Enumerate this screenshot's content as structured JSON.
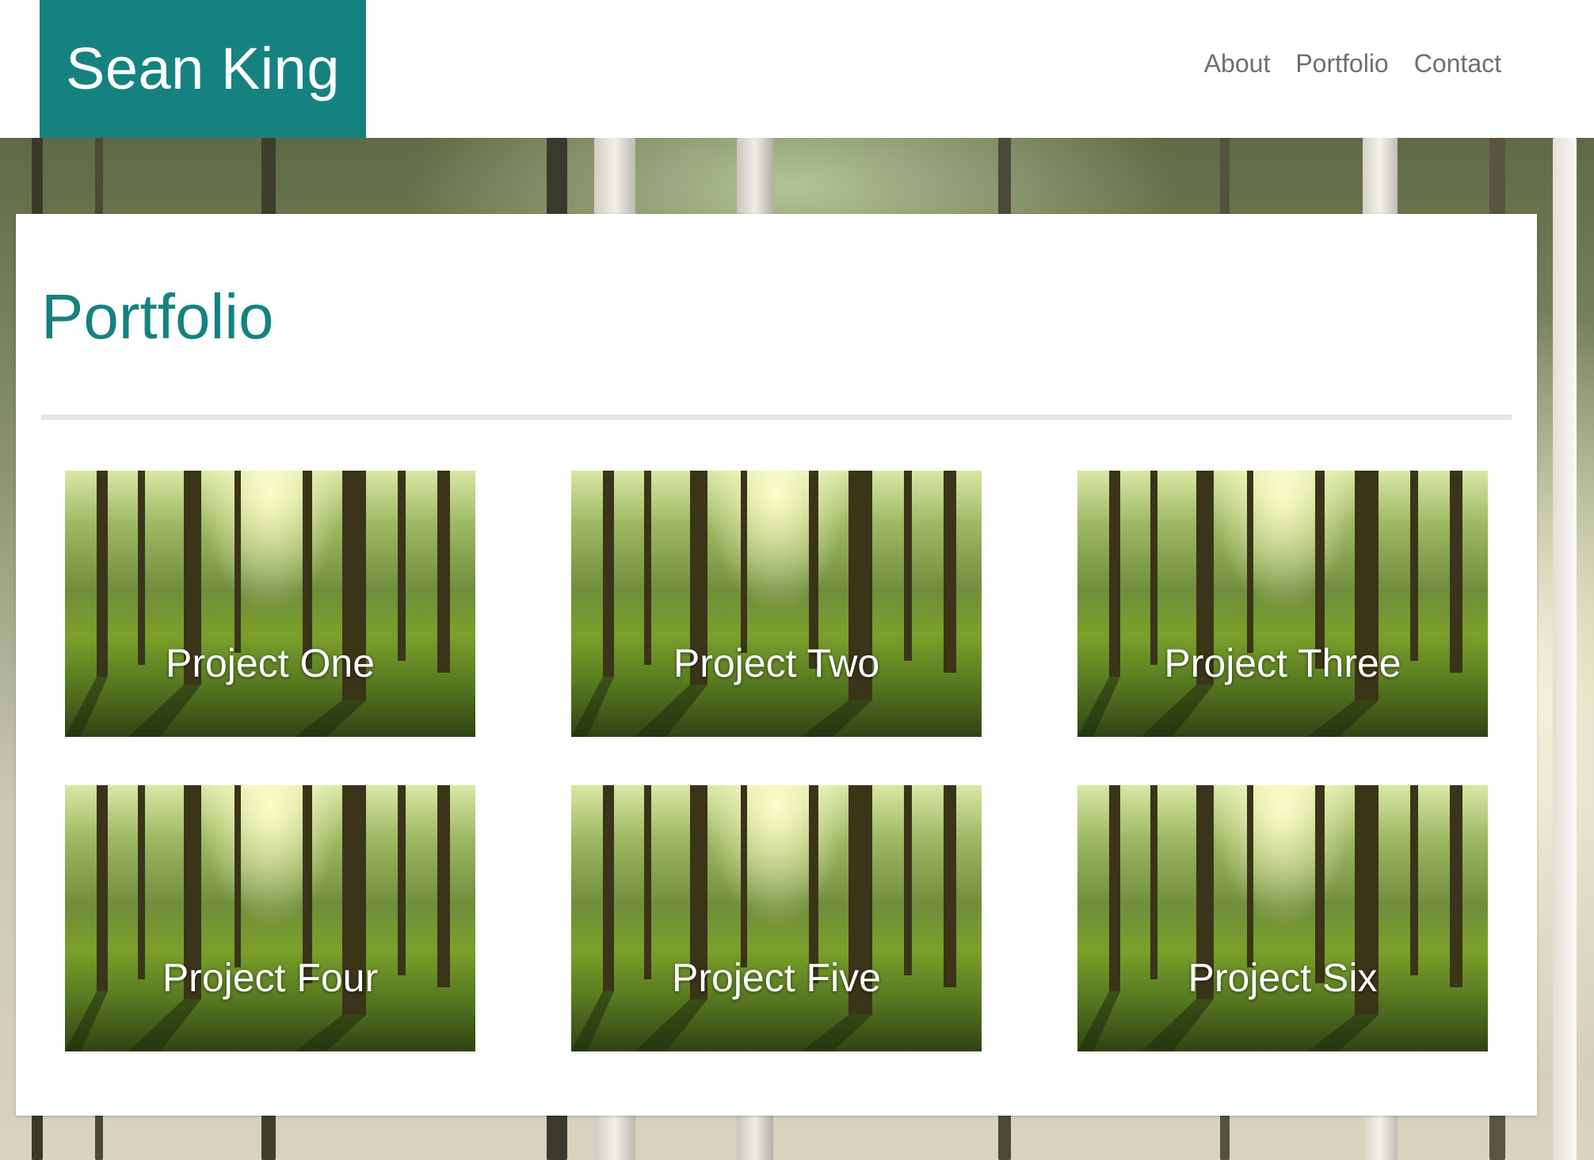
{
  "header": {
    "brand": "Sean King",
    "nav": [
      "About",
      "Portfolio",
      "Contact"
    ]
  },
  "main": {
    "title": "Portfolio",
    "projects": [
      {
        "label": "Project One"
      },
      {
        "label": "Project Two"
      },
      {
        "label": "Project Three"
      },
      {
        "label": "Project Four"
      },
      {
        "label": "Project Five"
      },
      {
        "label": "Project Six"
      }
    ]
  },
  "colors": {
    "accent": "#168280",
    "nav_text": "#6f6f6f",
    "divider": "#e6e6e6"
  }
}
